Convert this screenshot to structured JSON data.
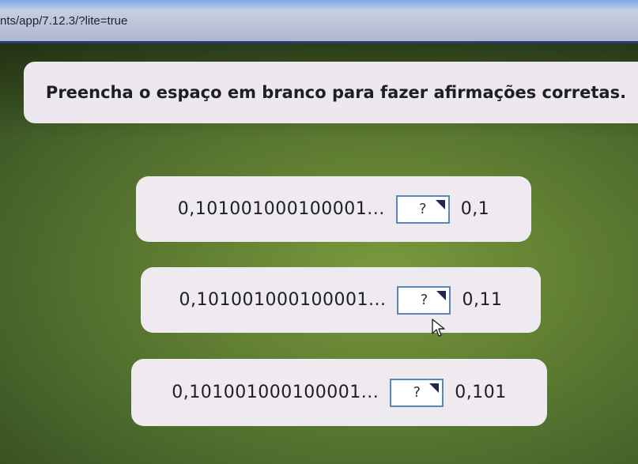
{
  "browser": {
    "url": "nts/app/7.12.3/?lite=true"
  },
  "instruction": "Preencha o espaço em branco para fazer afirmações corretas.",
  "statements": [
    {
      "left": "0,101001000100001...",
      "blank": "?",
      "right": "0,1"
    },
    {
      "left": "0,101001000100001...",
      "blank": "?",
      "right": "0,11"
    },
    {
      "left": "0,101001000100001...",
      "blank": "?",
      "right": "0,101"
    }
  ],
  "icons": {
    "cursor": "mouse-pointer-icon",
    "dropdown": "dropdown-corner-icon"
  }
}
